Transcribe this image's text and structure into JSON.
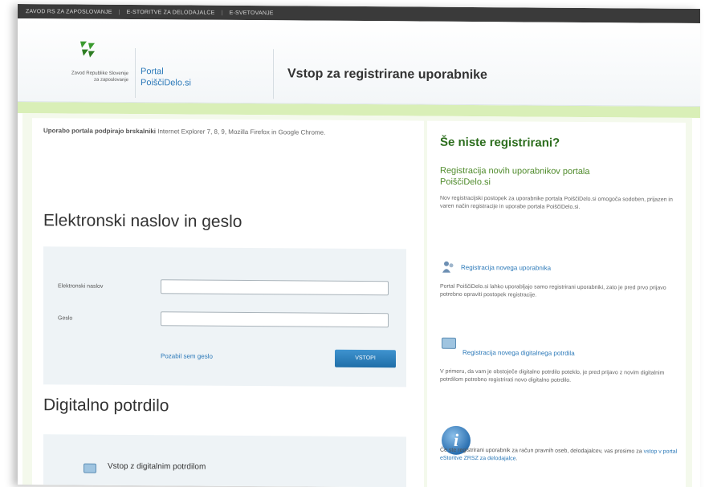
{
  "topnav": {
    "items": [
      "ZAVOD RS ZA ZAPOSLOVANJE",
      "E-STORITVE ZA DELODAJALCE",
      "E-SVETOVANJE"
    ]
  },
  "header": {
    "logo_text_line1": "Zavod Republike Slovenije",
    "logo_text_line2": "za zaposlovanje",
    "portal_line1": "Portal",
    "portal_line2": "PoiščiDelo.si",
    "title": "Vstop za registrirane uporabnike"
  },
  "left": {
    "browsers_bold": "Uporabo portala podpirajo brskalniki",
    "browsers_rest": " Internet Explorer 7, 8, 9, Mozilla Firefox in Google Chrome.",
    "email_heading": "Elektronski naslov in geslo",
    "email_label": "Elektronski naslov",
    "email_value": "",
    "password_label": "Geslo",
    "password_value": "",
    "forgot_link": "Pozabil sem geslo",
    "login_button": "VSTOPI",
    "cert_heading": "Digitalno potrdilo",
    "cert_button": "Vstop z digitalnim potrdilom"
  },
  "right": {
    "title": "Še niste registrirani?",
    "subtitle": "Registracija novih uporabnikov portala PoiščiDelo.si",
    "intro": "Nov registracijski postopek za uporabnike portala PoiščiDelo.si omogoča sodoben, prijazen in varen način registracije in uporabe portala PoiščiDelo.si.",
    "new_user_link": "Registracija novega uporabnika",
    "new_user_text": "Portal PoiščiDelo.si lahko uporabljajo samo registrirani uporabniki, zato je pred prvo prijavo potrebno opraviti postopek registracije.",
    "new_cert_link": "Registracija novega digitalnega potrdila",
    "new_cert_text": "V primeru, da vam je obstoječe digitalno potrdilo poteklo, je pred prijavo z novim digitalnim potrdilom potrebno registrirati novo digitalno potrdilo.",
    "info_text": "Če ste registrirani uporabnik za račun pravnih oseb, delodajalcev, vas prosimo za ",
    "info_link": "vstop v portal eStoritve ZRSZ za delodajalce",
    "info_end": "."
  },
  "colors": {
    "brand_green": "#2d6e1e",
    "link_blue": "#2a78b8",
    "button_blue": "#1f6ea8",
    "topnav_bg": "#3a3a3a",
    "green_band": "#d9efb7"
  }
}
